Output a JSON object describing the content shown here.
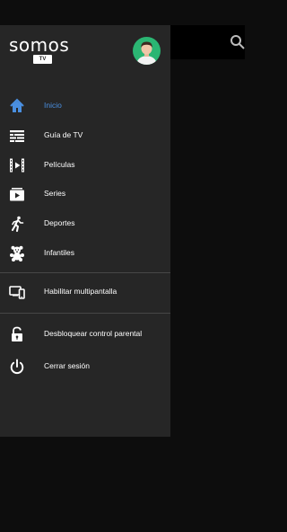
{
  "header": {
    "brand": "somos",
    "brand_badge": "TV"
  },
  "menu": [
    {
      "label": "Inicio",
      "icon": "home-icon",
      "active": true
    },
    {
      "label": "Guía de TV",
      "icon": "tv-guide-icon"
    },
    {
      "label": "Películas",
      "icon": "film-icon"
    },
    {
      "label": "Series",
      "icon": "series-icon"
    },
    {
      "label": "Deportes",
      "icon": "running-icon"
    },
    {
      "label": "Infantiles",
      "icon": "teddy-bear-icon"
    }
  ],
  "multiscreen": {
    "label": "Habilitar multipantalla",
    "icon": "multiscreen-icon"
  },
  "parental": {
    "label": "Desbloquear control parental",
    "icon": "unlock-icon"
  },
  "logout": {
    "label": "Cerrar sesión",
    "icon": "power-icon"
  },
  "colors": {
    "drawer_bg": "#262626",
    "accent": "#4a8fe0",
    "avatar_bg": "#2bb673",
    "page_bg": "#0d0d0d"
  }
}
